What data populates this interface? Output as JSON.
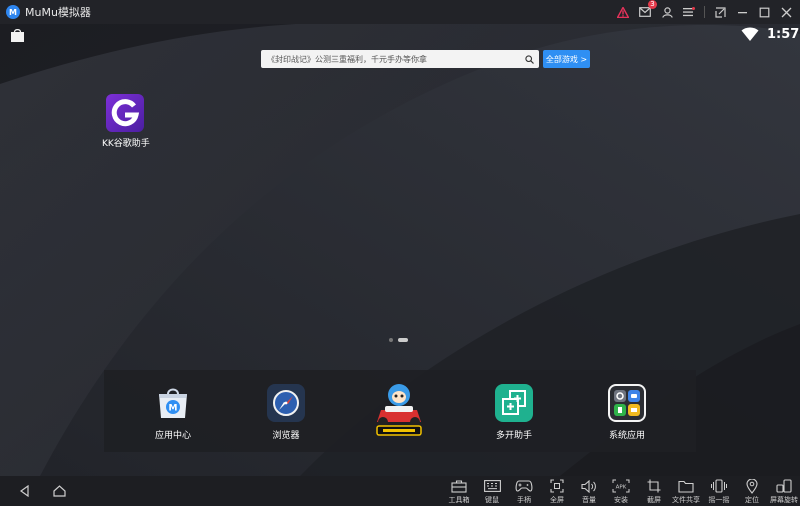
{
  "titlebar": {
    "title": "MuMu模拟器",
    "logo_text": "M",
    "notification_count": "3",
    "icons": [
      "warning-icon",
      "mail-icon",
      "user-icon",
      "menu-icon",
      "restore-icon",
      "minimize-icon",
      "maximize-icon",
      "close-icon"
    ],
    "warning_color": "#e5325a"
  },
  "status": {
    "time": "1:57"
  },
  "search": {
    "placeholder": "《封印战记》公测三重福利，千元手办等你拿",
    "button_label": "全部游戏 >"
  },
  "desktop_apps": [
    {
      "label": "KK谷歌助手",
      "icon": "google-g-icon"
    }
  ],
  "page_indicator": {
    "count": 2,
    "active": 1
  },
  "dock": [
    {
      "label": "应用中心",
      "icon": "app-center-icon"
    },
    {
      "label": "浏览器",
      "icon": "browser-compass-icon"
    },
    {
      "label": "",
      "icon": "kart-game-icon"
    },
    {
      "label": "多开助手",
      "icon": "multi-open-icon"
    },
    {
      "label": "系统应用",
      "icon": "system-apps-icon"
    }
  ],
  "toolbar": [
    {
      "label": "工具箱",
      "icon": "toolbox-icon"
    },
    {
      "label": "键鼠",
      "icon": "keyboard-icon"
    },
    {
      "label": "手柄",
      "icon": "gamepad-icon"
    },
    {
      "label": "全屏",
      "icon": "fullscreen-icon"
    },
    {
      "label": "音量",
      "icon": "volume-icon"
    },
    {
      "label": "安装",
      "icon": "apk-install-icon"
    },
    {
      "label": "截屏",
      "icon": "crop-icon"
    },
    {
      "label": "文件共享",
      "icon": "folder-icon"
    },
    {
      "label": "摇一摇",
      "icon": "shake-icon"
    },
    {
      "label": "定位",
      "icon": "location-icon"
    },
    {
      "label": "屏幕旋转",
      "icon": "rotate-icon"
    }
  ],
  "apk_text": "APK",
  "colors": {
    "accent": "#2f8ff3",
    "dock_bg": "#1e1f24"
  }
}
